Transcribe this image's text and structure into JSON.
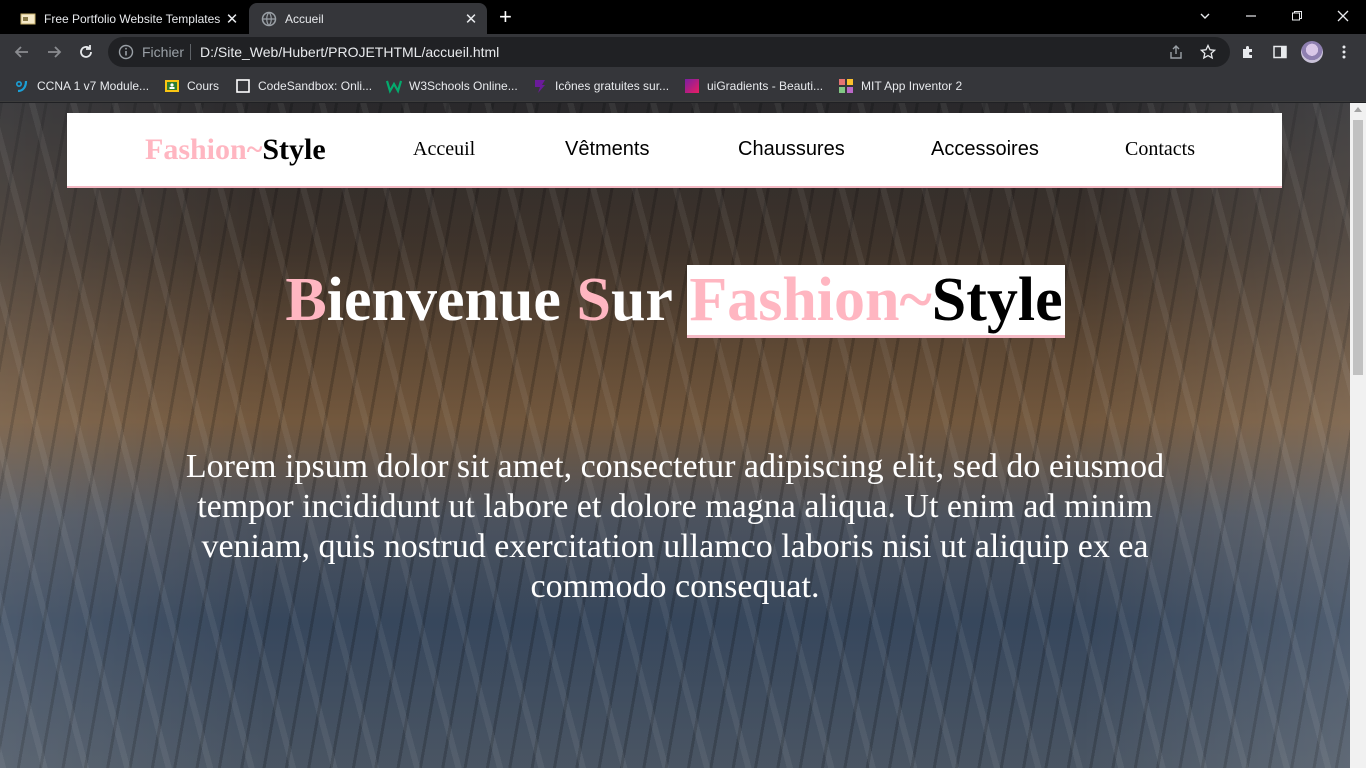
{
  "browser": {
    "tabs": [
      {
        "title": "Free Portfolio Website Templates",
        "active": false
      },
      {
        "title": "Accueil",
        "active": true
      }
    ],
    "address": {
      "scheme_label": "Fichier",
      "url": "D:/Site_Web/Hubert/PROJETHTML/accueil.html"
    },
    "bookmarks": [
      {
        "label": "CCNA 1 v7 Module...",
        "icon": "cisco-icon",
        "color": "#1ba0d7"
      },
      {
        "label": "Cours",
        "icon": "classroom-icon",
        "color": "#f9c513"
      },
      {
        "label": "CodeSandbox: Onli...",
        "icon": "codesandbox-icon",
        "color": "#ffffff"
      },
      {
        "label": "W3Schools Online...",
        "icon": "w3schools-icon",
        "color": "#04aa6d"
      },
      {
        "label": "Icônes gratuites sur...",
        "icon": "flaticon-icon",
        "color": "#6a1b9a"
      },
      {
        "label": "uiGradients - Beauti...",
        "icon": "uigradients-icon",
        "color": "#c2185b"
      },
      {
        "label": "MIT App Inventor 2",
        "icon": "appinventor-icon",
        "color": "#e57373"
      }
    ]
  },
  "site": {
    "logo": {
      "part1": "Fashion~",
      "part2": "Style"
    },
    "nav": [
      "Acceuil",
      "Vêtments",
      "Chaussures",
      "Accessoires",
      "Contacts"
    ],
    "hero": {
      "b": "B",
      "ienvenue": "ienvenue ",
      "s": "S",
      "ur": "ur ",
      "brand1": "Fashion~",
      "brand2": "Style",
      "text": "Lorem ipsum dolor sit amet, consectetur adipiscing elit, sed do eiusmod tempor incididunt ut labore et dolore magna aliqua. Ut enim ad minim veniam, quis nostrud exercitation ullamco laboris nisi ut aliquip ex ea commodo consequat."
    }
  },
  "colors": {
    "accent_pink": "#ffb6c1",
    "nav_border": "#f4b9c4"
  }
}
